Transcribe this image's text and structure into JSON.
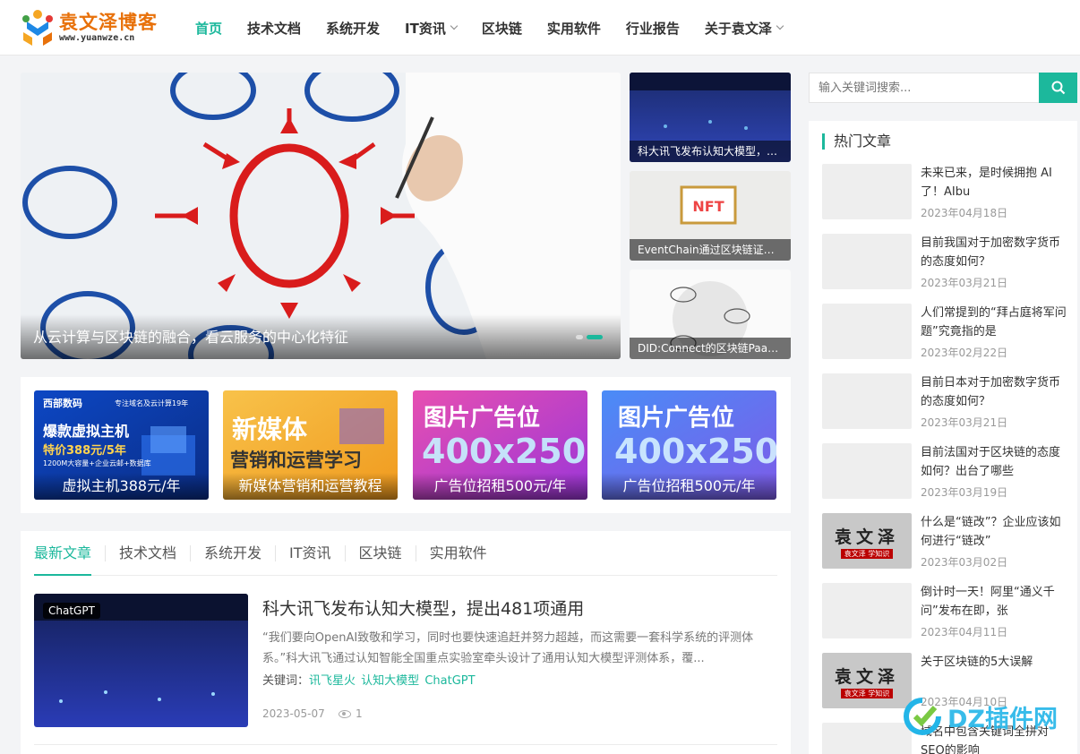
{
  "brand": {
    "name": "袁文泽博客",
    "domain": "www.yuanwze.cn"
  },
  "nav": [
    {
      "label": "首页",
      "active": true
    },
    {
      "label": "技术文档"
    },
    {
      "label": "系统开发"
    },
    {
      "label": "IT资讯",
      "dropdown": true
    },
    {
      "label": "区块链"
    },
    {
      "label": "实用软件"
    },
    {
      "label": "行业报告"
    },
    {
      "label": "关于袁文泽",
      "dropdown": true
    }
  ],
  "slider": {
    "main_caption": "从云计算与区块链的融合，看云服务的中心化特征",
    "side": [
      "科大讯飞发布认知大模型，提出481项通用...",
      "EventChain通过区块链证书...",
      "DID:Connect的区块链PaaS服..."
    ]
  },
  "ads": [
    {
      "caption": "虚拟主机388元/年",
      "brand": "西部数码",
      "brand_slogan": "专注域名及云计算19年",
      "line1": "爆款虚拟主机",
      "line2": "特价388元/5年",
      "line3": "1200M大容量+企业云邮+数据库"
    },
    {
      "caption": "新媒体营销和运营教程",
      "line1": "新媒体",
      "line2": "营销和运营学习"
    },
    {
      "caption": "广告位招租500元/年",
      "line1": "图片广告位",
      "line2": "400x250"
    },
    {
      "caption": "广告位招租500元/年",
      "line1": "图片广告位",
      "line2": "400x250"
    }
  ],
  "tabs": [
    "最新文章",
    "技术文档",
    "系统开发",
    "IT资讯",
    "区块链",
    "实用软件"
  ],
  "article": {
    "tag": "ChatGPT",
    "title": "科大讯飞发布认知大模型，提出481项通用",
    "desc": "“我们要向OpenAI致敬和学习，同时也要快速追赶并努力超越，而这需要一套科学系统的评测体系。”科大讯飞通过认知智能全国重点实验室牵头设计了通用认知大模型评测体系，覆...",
    "keywords_label": "关键词：",
    "keywords": [
      "讯飞星火",
      "认知大模型",
      "ChatGPT"
    ],
    "date": "2023-05-07",
    "views": "1"
  },
  "search": {
    "placeholder": "输入关键词搜索..."
  },
  "hot": {
    "title": "热门文章",
    "items": [
      {
        "title": "未来已来，是时候拥抱 AI 了！AIbu",
        "date": "2023年04月18日",
        "thumb": "blank"
      },
      {
        "title": "目前我国对于加密数字货币的态度如何？",
        "date": "2023年03月21日",
        "thumb": "blank"
      },
      {
        "title": "人们常提到的“拜占庭将军问题”究竟指的是",
        "date": "2023年02月22日",
        "thumb": "blank"
      },
      {
        "title": "目前日本对于加密数字货币的态度如何？",
        "date": "2023年03月21日",
        "thumb": "blank"
      },
      {
        "title": "目前法国对于区块链的态度如何？出台了哪些",
        "date": "2023年03月19日",
        "thumb": "blank"
      },
      {
        "title": "什么是“链改”？企业应该如何进行“链改”",
        "date": "2023年03月02日",
        "thumb": "logo"
      },
      {
        "title": "倒计时一天！阿里“通义千问”发布在即，张",
        "date": "2023年04月11日",
        "thumb": "blank"
      },
      {
        "title": "关于区块链的5大误解",
        "date": "2023年04月10日",
        "thumb": "logo"
      },
      {
        "title": "域名中包含关键词全拼对SEO的影响",
        "date": "",
        "thumb": "blank"
      }
    ],
    "logo_text": "袁文泽",
    "logo_sub": "袁文泽 学知识"
  },
  "watermark": "DZ插件网",
  "colors": {
    "accent": "#1cb89c",
    "logo": "#e8710a"
  }
}
